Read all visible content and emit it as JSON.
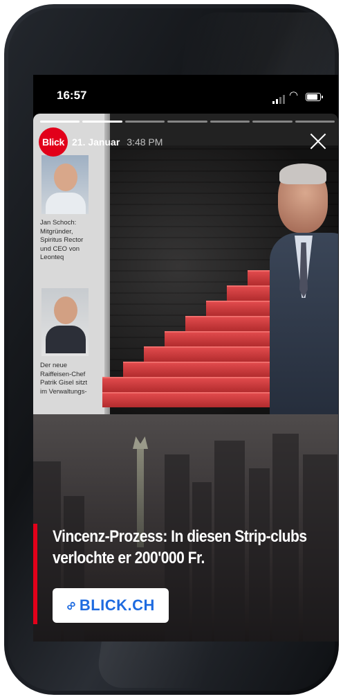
{
  "status_bar": {
    "time": "16:57"
  },
  "story": {
    "progress_segments": 7,
    "progress_done": 2,
    "publisher_logo": "Blick",
    "date": "21. Januar",
    "time": "3:48 PM",
    "close_icon": "close-icon",
    "photo": {
      "caption_1": "Jan Schoch: Mitgründer, Spiritus Rector und CEO von Leonteq",
      "caption_2": "Der neue Raiffeisen-Chef Patrik Gisel sitzt im Verwaltungs-"
    },
    "headline": "Vincenz-Prozess: In diesen Strip-clubs verlochte er 200'000 Fr.",
    "link": {
      "icon": "link-icon",
      "label": "BLICK.CH"
    }
  },
  "colors": {
    "brand_red": "#e2001a",
    "link_blue": "#1e6be0"
  }
}
